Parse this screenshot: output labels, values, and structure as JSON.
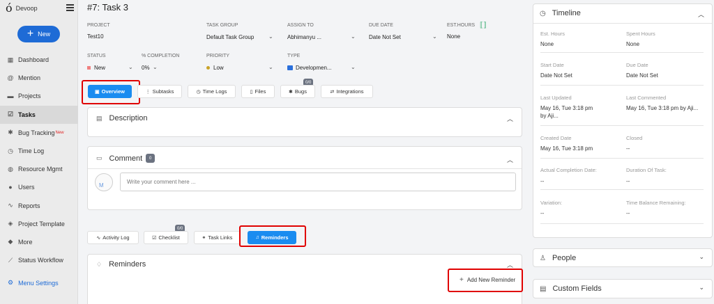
{
  "sidebar": {
    "brand": "Devoop",
    "new_label": "New",
    "items": [
      {
        "label": "Dashboard",
        "icon": "dashboard-icon",
        "glyph": "▦"
      },
      {
        "label": "Mention",
        "icon": "at-icon",
        "glyph": "@"
      },
      {
        "label": "Projects",
        "icon": "briefcase-icon",
        "glyph": "▬"
      },
      {
        "label": "Tasks",
        "icon": "checkbox-icon",
        "glyph": "☑"
      },
      {
        "label": "Bug Tracking",
        "icon": "bug-icon",
        "glyph": "✱",
        "sup": "New"
      },
      {
        "label": "Time Log",
        "icon": "clock-icon",
        "glyph": "◷"
      },
      {
        "label": "Resource Mgmt",
        "icon": "globe-icon",
        "glyph": "◍"
      },
      {
        "label": "Users",
        "icon": "user-icon",
        "glyph": "●"
      },
      {
        "label": "Reports",
        "icon": "chart-icon",
        "glyph": "∿"
      },
      {
        "label": "Project Template",
        "icon": "layers-icon",
        "glyph": "◈"
      },
      {
        "label": "More",
        "icon": "stack-icon",
        "glyph": "◆"
      },
      {
        "label": "Status Workflow",
        "icon": "workflow-icon",
        "glyph": "⟋"
      }
    ],
    "menu_settings": "Menu Settings"
  },
  "task": {
    "title": "#7: Task 3",
    "fields": {
      "project_label": "PROJECT",
      "project_value": "Test10",
      "group_label": "TASK GROUP",
      "group_value": "Default Task Group",
      "assign_label": "ASSIGN TO",
      "assign_value": "Abhimanyu ...",
      "due_label": "DUE DATE",
      "due_value": "Date Not Set",
      "est_label": "EST.HOURS",
      "est_value": "None",
      "status_label": "STATUS",
      "status_value": "New",
      "completion_label": "% COMPLETION",
      "completion_value": "0%",
      "priority_label": "PRIORITY",
      "priority_value": "Low",
      "type_label": "TYPE",
      "type_value": "Developmen..."
    }
  },
  "tabs": {
    "overview": "Overview",
    "subtasks": "Subtasks",
    "time_logs": "Time Logs",
    "files": "Files",
    "bugs": "Bugs",
    "bugs_badge": "0/0",
    "integrations": "Integrations"
  },
  "description": {
    "title": "Description"
  },
  "comment": {
    "title": "Comment",
    "badge": "0",
    "placeholder": "Write your comment here ...",
    "avatar_alt": "M"
  },
  "subtabs": {
    "activity_log": "Activity Log",
    "checklist": "Checklist",
    "checklist_badge": "0/0",
    "task_links": "Task Links",
    "reminders": "Reminders"
  },
  "reminders": {
    "title": "Reminders",
    "add_label": "Add New Reminder"
  },
  "timeline": {
    "title": "Timeline",
    "est_hours_label": "Est. Hours",
    "est_hours_value": "None",
    "spent_hours_label": "Spent Hours",
    "spent_hours_value": "None",
    "start_label": "Start Date",
    "start_value": "Date Not Set",
    "due_label": "Due Date",
    "due_value": "Date Not Set",
    "last_updated_label": "Last Updated",
    "last_updated_value": "May 16, Tue 3:18 pm",
    "last_updated_by": "by Aji...",
    "last_commented_label": "Last Commented",
    "last_commented_value": "May 16, Tue 3:18 pm by Aji...",
    "created_label": "Created Date",
    "created_value": "May 16, Tue 3:18 pm",
    "closed_label": "Closed",
    "closed_value": "--",
    "actual_label": "Actual Completion Date:",
    "actual_value": "--",
    "duration_label": "Duration Of Task:",
    "duration_value": "--",
    "variation_label": "Variation:",
    "variation_value": "--",
    "balance_label": "Time Balance Remaining:",
    "balance_value": "--"
  },
  "people": {
    "title": "People"
  },
  "custom_fields": {
    "title": "Custom Fields"
  },
  "colors": {
    "primary": "#1a8cf0",
    "new_button": "#1e6bd6",
    "highlight": "#e00000",
    "status_new": "#f08080",
    "priority_low": "#c9a227"
  }
}
